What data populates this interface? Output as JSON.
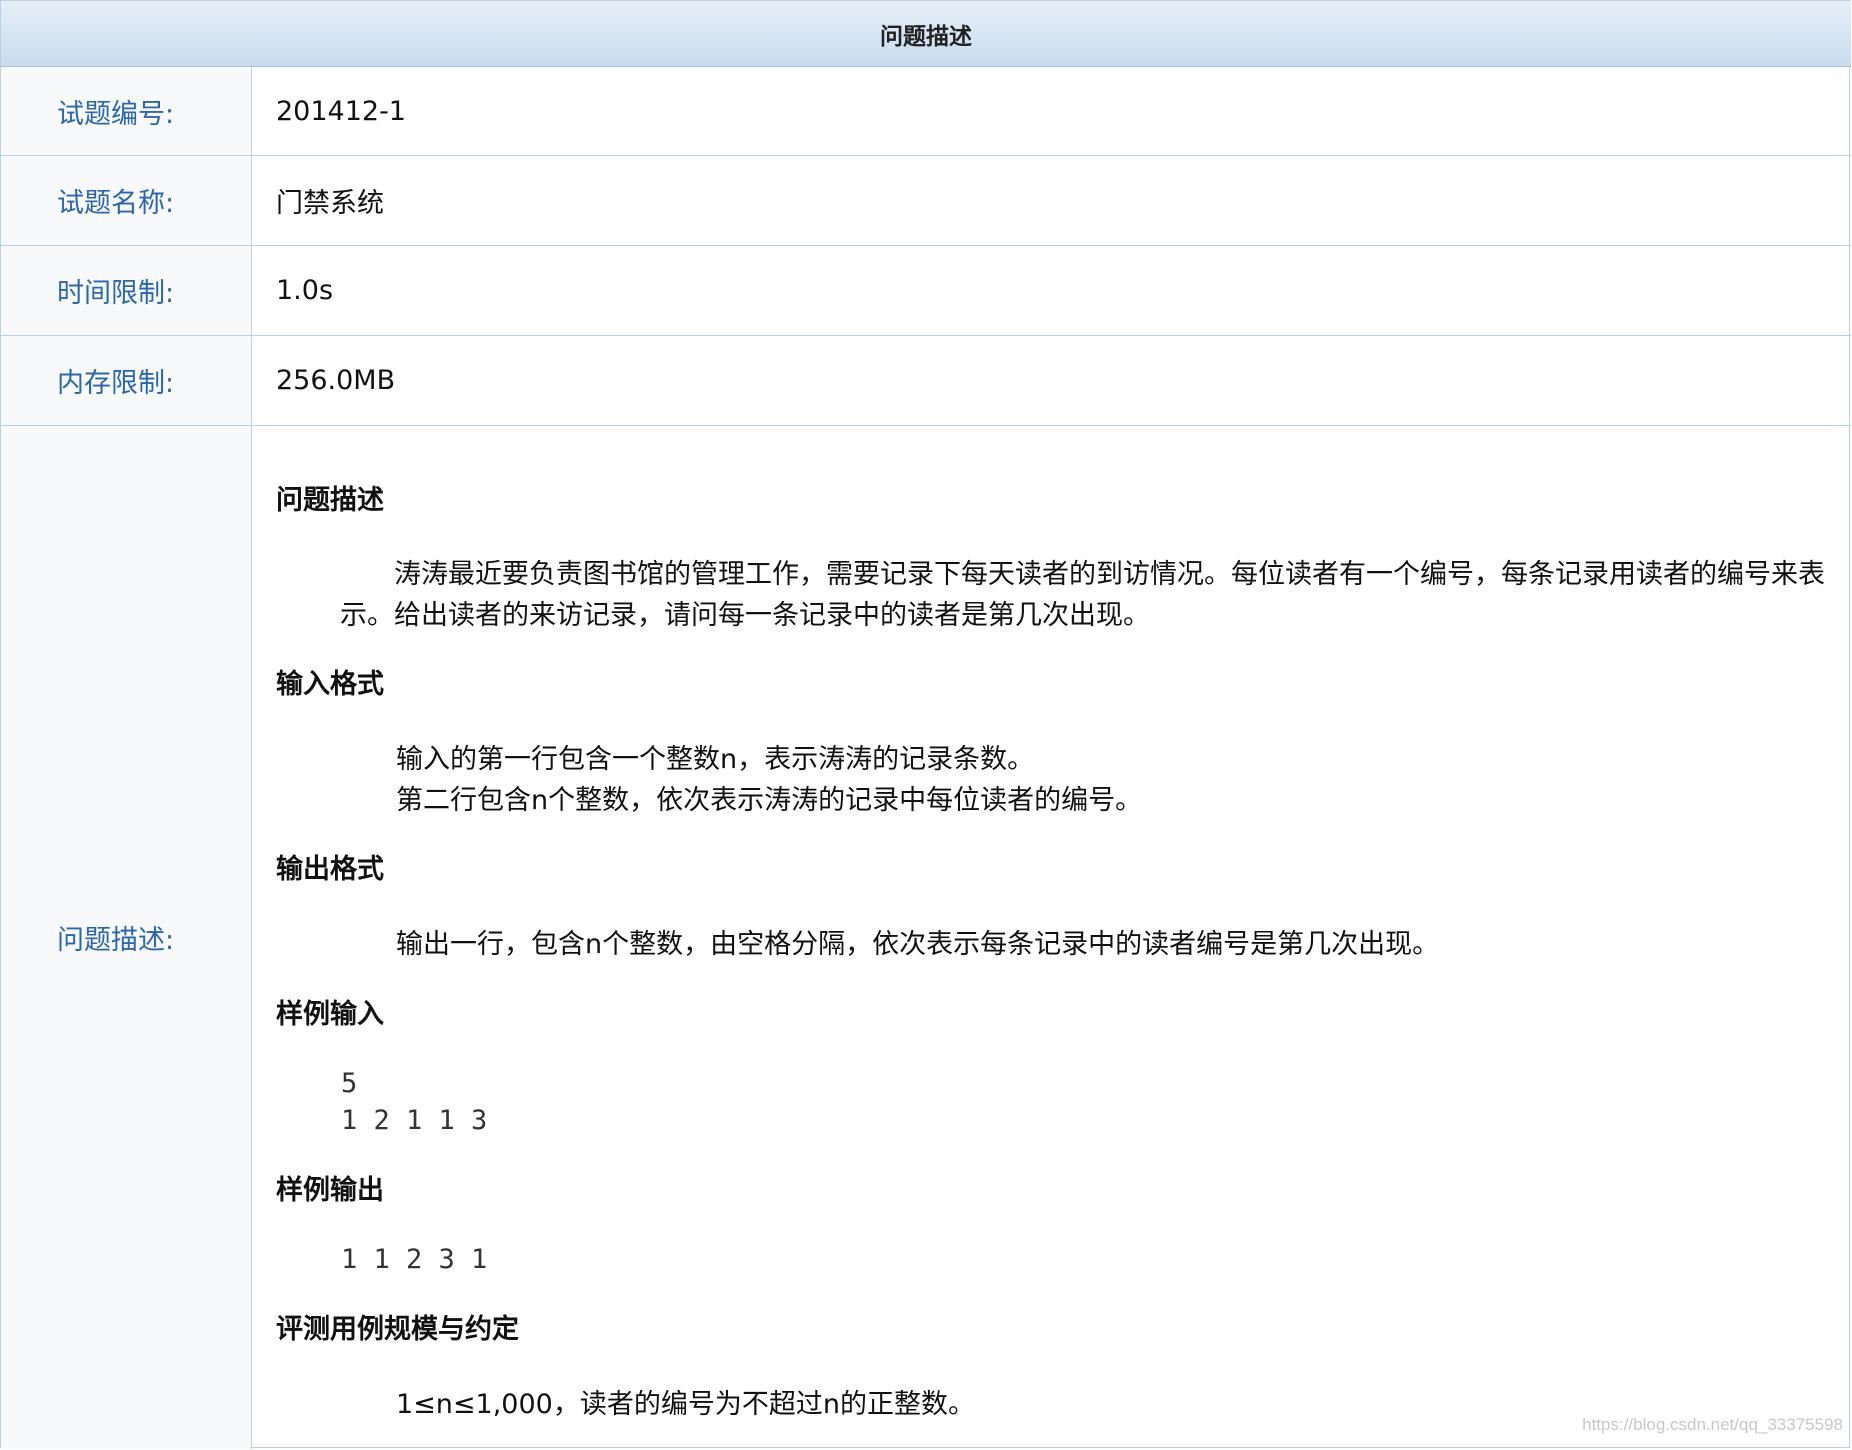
{
  "header": {
    "title": "问题描述"
  },
  "info_rows": [
    {
      "label": "试题编号:",
      "value": "201412-1"
    },
    {
      "label": "试题名称:",
      "value": "门禁系统"
    },
    {
      "label": "时间限制:",
      "value": "1.0s"
    },
    {
      "label": "内存限制:",
      "value": "256.0MB"
    }
  ],
  "description": {
    "label": "问题描述:",
    "sections": {
      "problem_title": "问题描述",
      "problem_text": "涛涛最近要负责图书馆的管理工作，需要记录下每天读者的到访情况。每位读者有一个编号，每条记录用读者的编号来表示。给出读者的来访记录，请问每一条记录中的读者是第几次出现。",
      "input_title": "输入格式",
      "input_line1": "输入的第一行包含一个整数n，表示涛涛的记录条数。",
      "input_line2": "第二行包含n个整数，依次表示涛涛的记录中每位读者的编号。",
      "output_title": "输出格式",
      "output_text": "输出一行，包含n个整数，由空格分隔，依次表示每条记录中的读者编号是第几次出现。",
      "sample_input_title": "样例输入",
      "sample_input_line1": "5",
      "sample_input_line2": "1 2 1 1 3",
      "sample_output_title": "样例输出",
      "sample_output_line1": "1 1 2 3 1",
      "scale_title": "评测用例规模与约定",
      "scale_text": "1≤n≤1,000，读者的编号为不超过n的正整数。"
    }
  },
  "watermark": "https://blog.csdn.net/qq_33375598"
}
